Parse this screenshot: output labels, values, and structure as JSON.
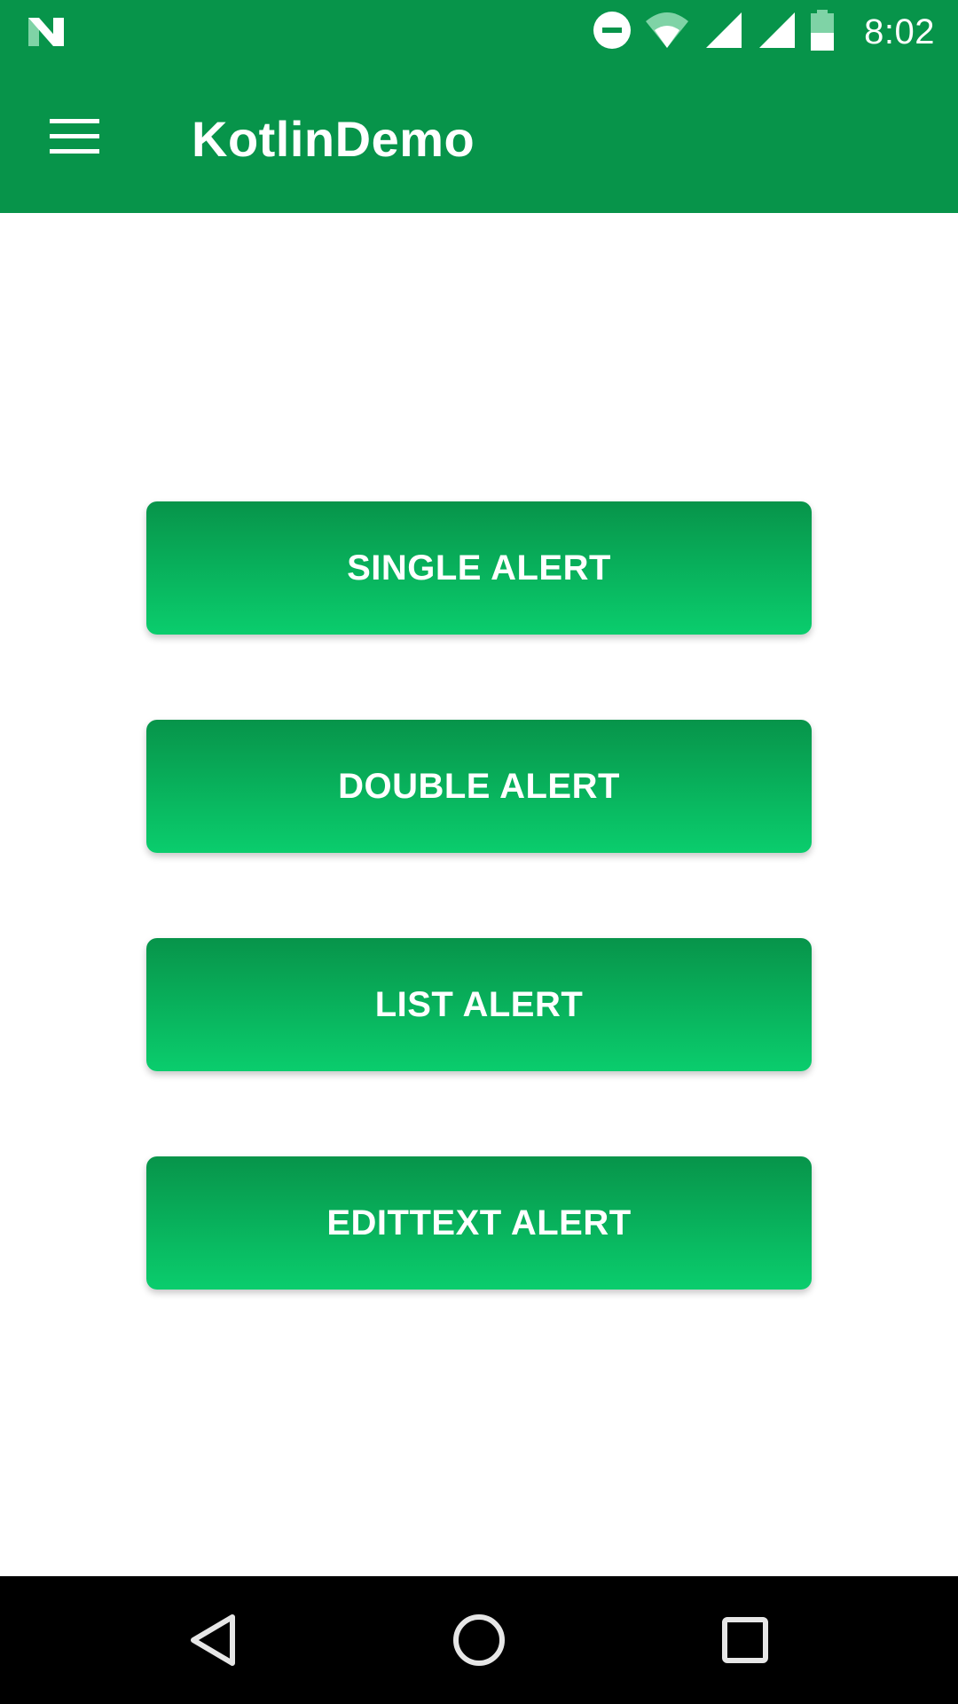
{
  "status_bar": {
    "time": "8:02",
    "icons": [
      "notification-n-icon",
      "do-not-disturb-icon",
      "wifi-icon",
      "cell-signal-icon",
      "cell-signal-icon",
      "battery-icon"
    ],
    "background": "#07944a"
  },
  "app_bar": {
    "title": "KotlinDemo",
    "menu_icon": "hamburger-menu-icon",
    "background": "#07944a"
  },
  "buttons": [
    {
      "label": "SINGLE ALERT"
    },
    {
      "label": "DOUBLE ALERT"
    },
    {
      "label": "LIST ALERT"
    },
    {
      "label": "EDITTEXT ALERT"
    }
  ],
  "button_gradient": {
    "top": "#07944a",
    "bottom": "#0acd6d"
  },
  "nav_bar": {
    "icons": [
      "back-icon",
      "home-icon",
      "recents-icon"
    ],
    "background": "#000000"
  }
}
